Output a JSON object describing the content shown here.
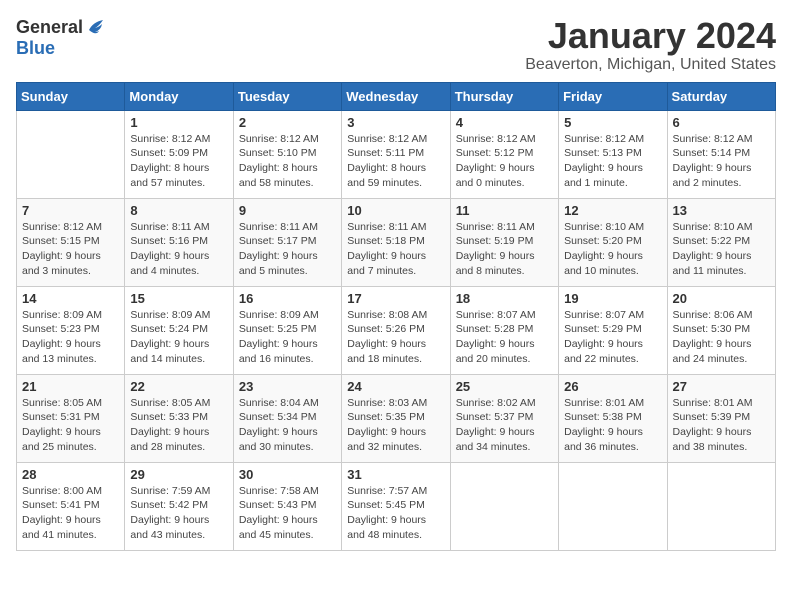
{
  "header": {
    "logo_general": "General",
    "logo_blue": "Blue",
    "title": "January 2024",
    "subtitle": "Beaverton, Michigan, United States"
  },
  "weekdays": [
    "Sunday",
    "Monday",
    "Tuesday",
    "Wednesday",
    "Thursday",
    "Friday",
    "Saturday"
  ],
  "weeks": [
    [
      {
        "day": "",
        "info": ""
      },
      {
        "day": "1",
        "info": "Sunrise: 8:12 AM\nSunset: 5:09 PM\nDaylight: 8 hours\nand 57 minutes."
      },
      {
        "day": "2",
        "info": "Sunrise: 8:12 AM\nSunset: 5:10 PM\nDaylight: 8 hours\nand 58 minutes."
      },
      {
        "day": "3",
        "info": "Sunrise: 8:12 AM\nSunset: 5:11 PM\nDaylight: 8 hours\nand 59 minutes."
      },
      {
        "day": "4",
        "info": "Sunrise: 8:12 AM\nSunset: 5:12 PM\nDaylight: 9 hours\nand 0 minutes."
      },
      {
        "day": "5",
        "info": "Sunrise: 8:12 AM\nSunset: 5:13 PM\nDaylight: 9 hours\nand 1 minute."
      },
      {
        "day": "6",
        "info": "Sunrise: 8:12 AM\nSunset: 5:14 PM\nDaylight: 9 hours\nand 2 minutes."
      }
    ],
    [
      {
        "day": "7",
        "info": "Sunrise: 8:12 AM\nSunset: 5:15 PM\nDaylight: 9 hours\nand 3 minutes."
      },
      {
        "day": "8",
        "info": "Sunrise: 8:11 AM\nSunset: 5:16 PM\nDaylight: 9 hours\nand 4 minutes."
      },
      {
        "day": "9",
        "info": "Sunrise: 8:11 AM\nSunset: 5:17 PM\nDaylight: 9 hours\nand 5 minutes."
      },
      {
        "day": "10",
        "info": "Sunrise: 8:11 AM\nSunset: 5:18 PM\nDaylight: 9 hours\nand 7 minutes."
      },
      {
        "day": "11",
        "info": "Sunrise: 8:11 AM\nSunset: 5:19 PM\nDaylight: 9 hours\nand 8 minutes."
      },
      {
        "day": "12",
        "info": "Sunrise: 8:10 AM\nSunset: 5:20 PM\nDaylight: 9 hours\nand 10 minutes."
      },
      {
        "day": "13",
        "info": "Sunrise: 8:10 AM\nSunset: 5:22 PM\nDaylight: 9 hours\nand 11 minutes."
      }
    ],
    [
      {
        "day": "14",
        "info": "Sunrise: 8:09 AM\nSunset: 5:23 PM\nDaylight: 9 hours\nand 13 minutes."
      },
      {
        "day": "15",
        "info": "Sunrise: 8:09 AM\nSunset: 5:24 PM\nDaylight: 9 hours\nand 14 minutes."
      },
      {
        "day": "16",
        "info": "Sunrise: 8:09 AM\nSunset: 5:25 PM\nDaylight: 9 hours\nand 16 minutes."
      },
      {
        "day": "17",
        "info": "Sunrise: 8:08 AM\nSunset: 5:26 PM\nDaylight: 9 hours\nand 18 minutes."
      },
      {
        "day": "18",
        "info": "Sunrise: 8:07 AM\nSunset: 5:28 PM\nDaylight: 9 hours\nand 20 minutes."
      },
      {
        "day": "19",
        "info": "Sunrise: 8:07 AM\nSunset: 5:29 PM\nDaylight: 9 hours\nand 22 minutes."
      },
      {
        "day": "20",
        "info": "Sunrise: 8:06 AM\nSunset: 5:30 PM\nDaylight: 9 hours\nand 24 minutes."
      }
    ],
    [
      {
        "day": "21",
        "info": "Sunrise: 8:05 AM\nSunset: 5:31 PM\nDaylight: 9 hours\nand 25 minutes."
      },
      {
        "day": "22",
        "info": "Sunrise: 8:05 AM\nSunset: 5:33 PM\nDaylight: 9 hours\nand 28 minutes."
      },
      {
        "day": "23",
        "info": "Sunrise: 8:04 AM\nSunset: 5:34 PM\nDaylight: 9 hours\nand 30 minutes."
      },
      {
        "day": "24",
        "info": "Sunrise: 8:03 AM\nSunset: 5:35 PM\nDaylight: 9 hours\nand 32 minutes."
      },
      {
        "day": "25",
        "info": "Sunrise: 8:02 AM\nSunset: 5:37 PM\nDaylight: 9 hours\nand 34 minutes."
      },
      {
        "day": "26",
        "info": "Sunrise: 8:01 AM\nSunset: 5:38 PM\nDaylight: 9 hours\nand 36 minutes."
      },
      {
        "day": "27",
        "info": "Sunrise: 8:01 AM\nSunset: 5:39 PM\nDaylight: 9 hours\nand 38 minutes."
      }
    ],
    [
      {
        "day": "28",
        "info": "Sunrise: 8:00 AM\nSunset: 5:41 PM\nDaylight: 9 hours\nand 41 minutes."
      },
      {
        "day": "29",
        "info": "Sunrise: 7:59 AM\nSunset: 5:42 PM\nDaylight: 9 hours\nand 43 minutes."
      },
      {
        "day": "30",
        "info": "Sunrise: 7:58 AM\nSunset: 5:43 PM\nDaylight: 9 hours\nand 45 minutes."
      },
      {
        "day": "31",
        "info": "Sunrise: 7:57 AM\nSunset: 5:45 PM\nDaylight: 9 hours\nand 48 minutes."
      },
      {
        "day": "",
        "info": ""
      },
      {
        "day": "",
        "info": ""
      },
      {
        "day": "",
        "info": ""
      }
    ]
  ]
}
